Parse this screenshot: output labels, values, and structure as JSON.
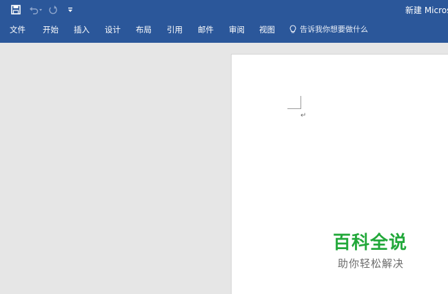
{
  "titlebar": {
    "doc_title": "新建 Microsoft",
    "qat": [
      {
        "name": "save-icon"
      },
      {
        "name": "undo-icon"
      },
      {
        "name": "redo-icon"
      },
      {
        "name": "customize-qat-icon"
      }
    ]
  },
  "ribbon": {
    "tabs": [
      {
        "label": "文件"
      },
      {
        "label": "开始"
      },
      {
        "label": "插入"
      },
      {
        "label": "设计"
      },
      {
        "label": "布局"
      },
      {
        "label": "引用"
      },
      {
        "label": "邮件"
      },
      {
        "label": "审阅"
      },
      {
        "label": "视图"
      }
    ],
    "tell_me": "告诉我你想要做什么"
  },
  "document": {
    "paragraph_mark": "↵"
  },
  "watermark": {
    "title": "百科全说",
    "subtitle": "助你轻松解决"
  },
  "colors": {
    "ribbon_blue": "#2b579a",
    "workspace_gray": "#e6e6e6",
    "watermark_green": "#22a83a"
  }
}
